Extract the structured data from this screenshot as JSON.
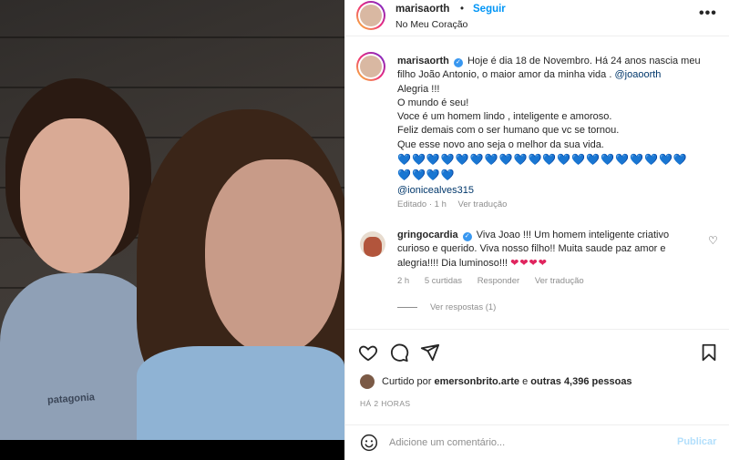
{
  "post": {
    "username": "marisaorth",
    "follow_label": "Seguir",
    "dot": "•",
    "location": "No Meu Coração",
    "more": "•••"
  },
  "caption": {
    "username": "marisaorth",
    "line1": "Hoje é dia 18 de Novembro. Há 24 anos nascia meu filho João Antonio, o maior amor da minha vida .",
    "mention1": "@joaoorth",
    "line2": "Alegria !!!",
    "line3": "O mundo é seu!",
    "line4": "Voce é um homem lindo , inteligente e amoroso.",
    "line5": "Feliz demais com o ser humano que vc se tornou.",
    "line6": "Que esse novo ano seja o melhor da sua vida.",
    "hearts1": "💙💙💙💙💙💙💙💙💙💙💙💙💙💙💙💙💙💙💙💙",
    "hearts2": "💙💙💙💙",
    "mention2": "@ionicealves315",
    "edited": "Editado · 1 h",
    "see_translation": "Ver tradução"
  },
  "comment": {
    "username": "gringocardia",
    "text": "Viva Joao !!! Um homem inteligente criativo curioso e querido. Viva nosso filho!! Muita saude paz amor e alegria!!!! Dia luminoso!!!",
    "hearts": "❤❤❤❤",
    "time": "2 h",
    "likes": "5 curtidas",
    "reply": "Responder",
    "see_translation": "Ver tradução",
    "view_replies": "Ver respostas (1)"
  },
  "shirt_text": "patagonia",
  "likes": {
    "prefix": "Curtido por",
    "user": "emersonbrito.arte",
    "middle": "e",
    "others": "outras 4,396 pessoas"
  },
  "time_ago": "HÁ 2 HORAS",
  "add_comment": {
    "placeholder": "Adicione um comentário...",
    "publish": "Publicar"
  },
  "colors": {
    "link_blue": "#0095f6",
    "verified": "#3897f0",
    "muted": "#8e8e8e"
  }
}
